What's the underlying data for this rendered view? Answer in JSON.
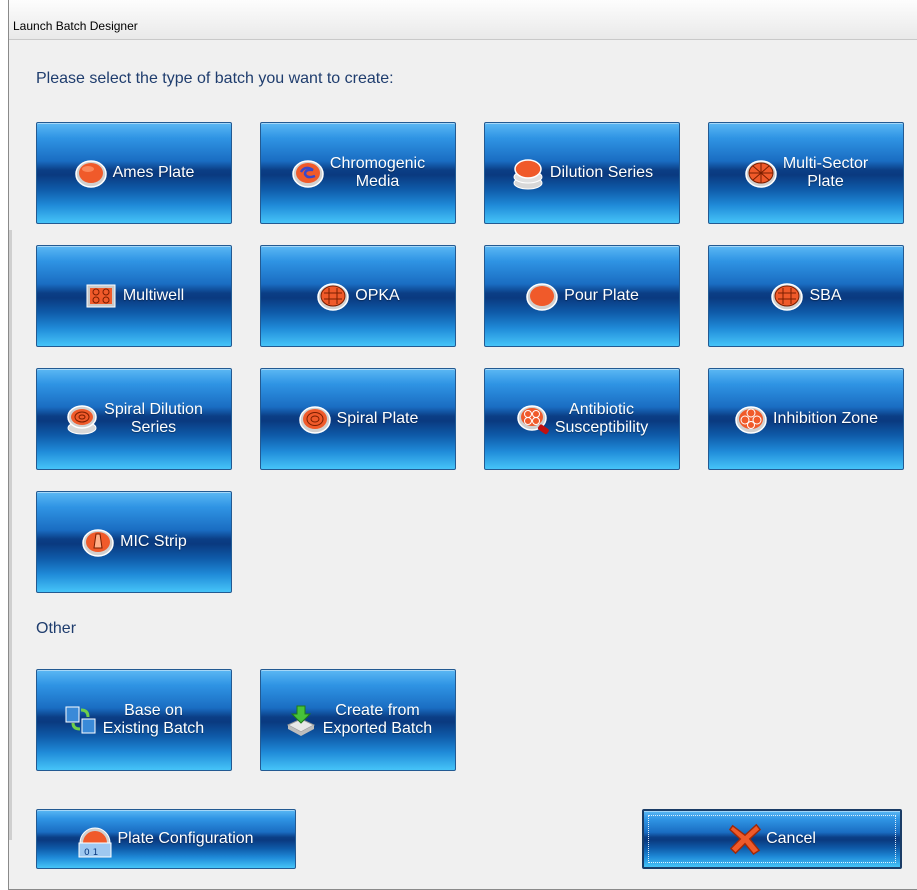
{
  "window": {
    "title": "Launch Batch Designer"
  },
  "heading": "Please select the type of batch you want to create:",
  "batch_types": [
    {
      "label": "Ames Plate",
      "icon": "ames-plate-icon"
    },
    {
      "label": "Chromogenic\nMedia",
      "icon": "chromogenic-media-icon"
    },
    {
      "label": "Dilution Series",
      "icon": "dilution-series-icon"
    },
    {
      "label": "Multi-Sector\nPlate",
      "icon": "multi-sector-plate-icon"
    },
    {
      "label": "Multiwell",
      "icon": "multiwell-icon"
    },
    {
      "label": "OPKA",
      "icon": "opka-icon"
    },
    {
      "label": "Pour Plate",
      "icon": "pour-plate-icon"
    },
    {
      "label": "SBA",
      "icon": "sba-icon"
    },
    {
      "label": "Spiral Dilution\nSeries",
      "icon": "spiral-dilution-series-icon"
    },
    {
      "label": "Spiral Plate",
      "icon": "spiral-plate-icon"
    },
    {
      "label": "Antibiotic\nSusceptibility",
      "icon": "antibiotic-susceptibility-icon"
    },
    {
      "label": "Inhibition Zone",
      "icon": "inhibition-zone-icon"
    },
    {
      "label": "MIC Strip",
      "icon": "mic-strip-icon"
    }
  ],
  "other": {
    "label": "Other",
    "buttons": [
      {
        "label": "Base on\nExisting Batch",
        "icon": "copy-batch-icon"
      },
      {
        "label": "Create from\nExported Batch",
        "icon": "import-batch-icon"
      }
    ]
  },
  "footer": {
    "plate_configuration": "Plate Configuration",
    "cancel": "Cancel"
  },
  "colors": {
    "button_top": "#5bb8f4",
    "button_mid": "#0a3a80",
    "button_bottom": "#46c4f8",
    "heading": "#1f3d6e",
    "dish_red": "#f05a2a"
  }
}
